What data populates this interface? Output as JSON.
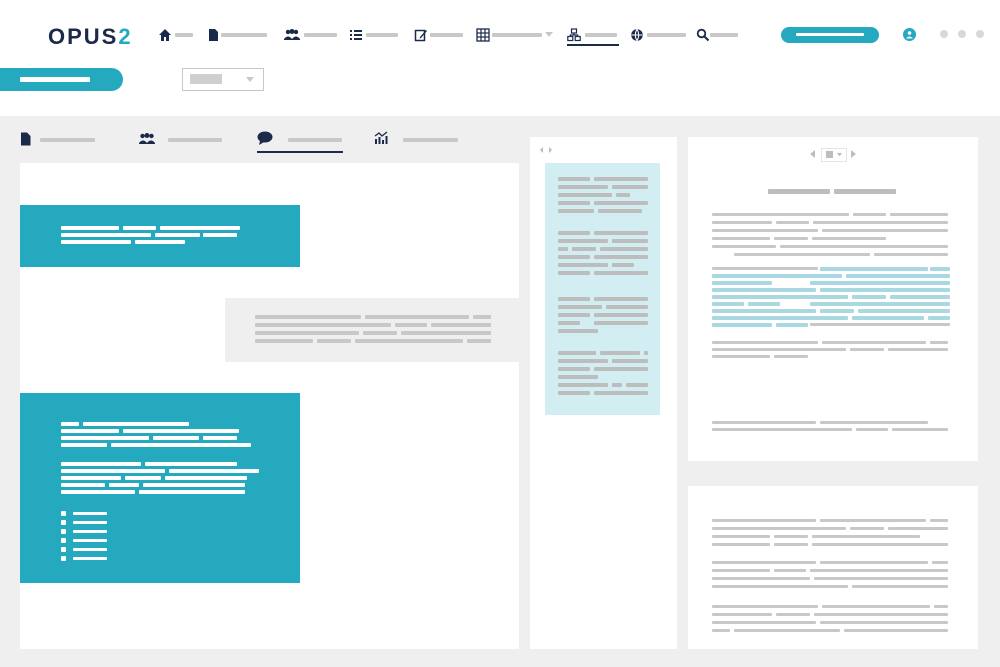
{
  "app": {
    "logo_text": "OPUS",
    "logo_suffix": "2",
    "brand_color": "#1b2a49",
    "accent_color": "#24a9bf"
  },
  "nav": {
    "items": [
      {
        "icon": "home-icon"
      },
      {
        "icon": "document-icon"
      },
      {
        "icon": "people-icon"
      },
      {
        "icon": "list-icon"
      },
      {
        "icon": "edit-icon"
      },
      {
        "icon": "table-icon",
        "has_dropdown": true
      },
      {
        "icon": "hierarchy-icon",
        "active": true
      },
      {
        "icon": "globe-icon"
      },
      {
        "icon": "search-icon"
      }
    ],
    "user_icon": "user-icon",
    "more_icon": "more-dots-icon"
  },
  "toolbar": {
    "dropdown_icon": "chevron-down-icon"
  },
  "tabs": [
    {
      "icon": "document-icon"
    },
    {
      "icon": "people-icon"
    },
    {
      "icon": "comment-icon",
      "active": true
    },
    {
      "icon": "analytics-icon"
    }
  ],
  "viewer": {
    "pager_prev_icon": "chevron-left-icon",
    "pager_next_icon": "chevron-right-icon",
    "pane_toggle_icon": "pane-toggle-icon"
  }
}
